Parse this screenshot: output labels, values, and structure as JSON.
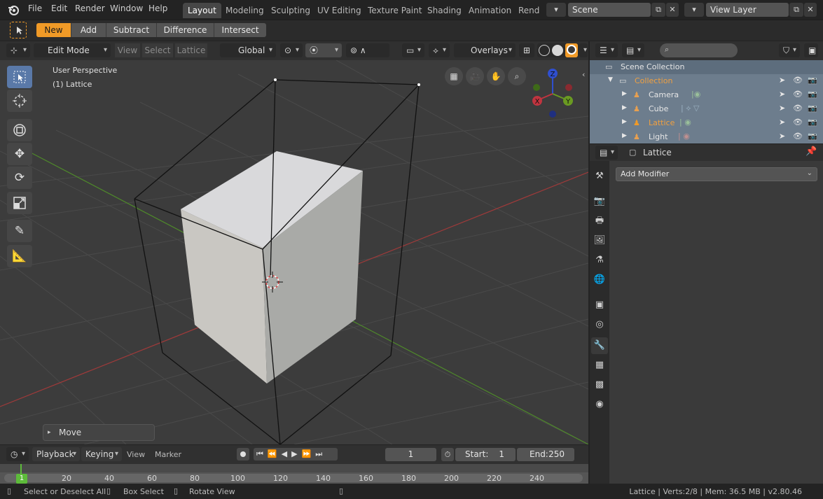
{
  "menu": {
    "items": [
      "File",
      "Edit",
      "Render",
      "Window",
      "Help"
    ]
  },
  "workspaces": [
    "Layout",
    "Modeling",
    "Sculpting",
    "UV Editing",
    "Texture Paint",
    "Shading",
    "Animation",
    "Rende"
  ],
  "scene": {
    "name": "Scene",
    "view_layer": "View Layer"
  },
  "tool_header": {
    "modes": [
      "New",
      "Add",
      "Subtract",
      "Difference",
      "Intersect"
    ]
  },
  "viewport_header": {
    "mode": "Edit Mode",
    "view": "View",
    "select": "Select",
    "lattice": "Lattice",
    "orientation": "Global",
    "overlays": "Overlays"
  },
  "viewport": {
    "perspective": "User Perspective",
    "object_label": "(1) Lattice",
    "last_op": "Move",
    "axes": {
      "x": "X",
      "y": "Y",
      "z": "Z"
    }
  },
  "outliner": {
    "root": "Scene Collection",
    "collection": "Collection",
    "items": [
      "Camera",
      "Cube",
      "Lattice",
      "Light"
    ]
  },
  "properties": {
    "object_name": "Lattice",
    "add_modifier": "Add Modifier"
  },
  "timeline": {
    "playback": "Playback",
    "keying": "Keying",
    "view": "View",
    "marker": "Marker",
    "current_frame": "1",
    "start_label": "Start:",
    "start": "1",
    "end_label": "End:",
    "end": "250",
    "ticks": [
      "20",
      "40",
      "60",
      "80",
      "100",
      "120",
      "140",
      "160",
      "180",
      "200",
      "220",
      "240"
    ],
    "current_tick": "1"
  },
  "status": {
    "left1": "Select or Deselect All",
    "left2": "Box Select",
    "left3": "Rotate View",
    "right": "Lattice | Verts:2/8 | Mem: 36.5 MB | v2.80.46"
  },
  "colors": {
    "accent": "#f09a27",
    "active_tool": "#5a79a8",
    "x_axis": "#c0343f",
    "y_axis": "#6a9a22",
    "z_axis": "#2f4fd0"
  }
}
